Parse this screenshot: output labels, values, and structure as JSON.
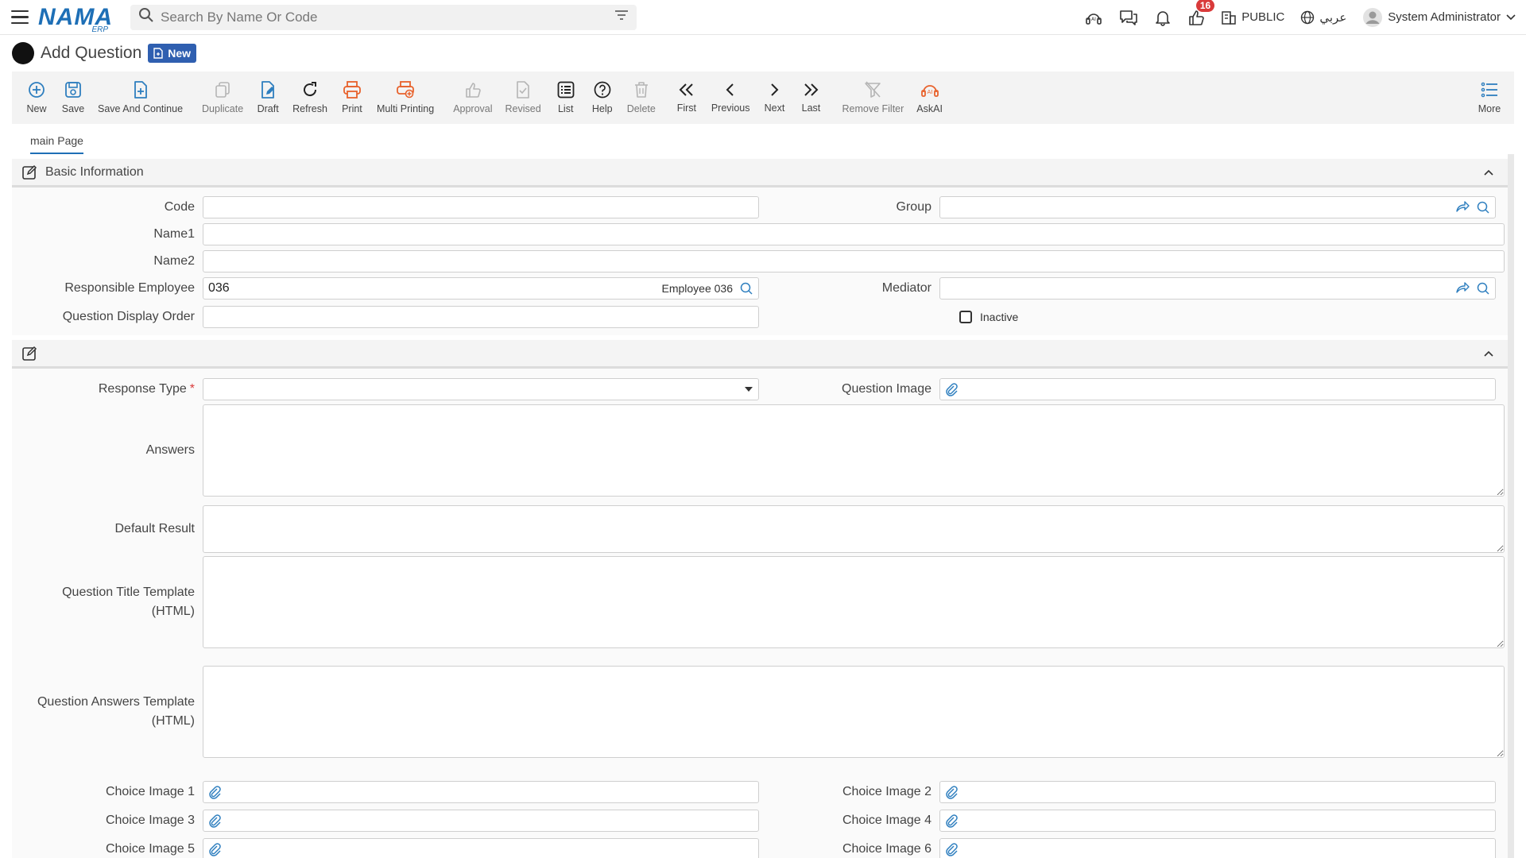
{
  "topbar": {
    "logo_main": "NAMA",
    "logo_sub": "ERP",
    "search_placeholder": "Search By Name Or Code",
    "notifications_count": "16",
    "public_label": "PUBLIC",
    "language_label": "عربي",
    "user_name": "System Administrator"
  },
  "page": {
    "title": "Add Question",
    "status_badge": "New"
  },
  "toolbar": {
    "items": [
      {
        "label": "New",
        "icon": "plus-circle-icon"
      },
      {
        "label": "Save",
        "icon": "save-icon"
      },
      {
        "label": "Save And Continue",
        "icon": "save-continue-icon"
      },
      {
        "label": "Duplicate",
        "icon": "duplicate-icon"
      },
      {
        "label": "Draft",
        "icon": "draft-icon"
      },
      {
        "label": "Refresh",
        "icon": "refresh-icon"
      },
      {
        "label": "Print",
        "icon": "print-icon"
      },
      {
        "label": "Multi Printing",
        "icon": "multi-print-icon"
      },
      {
        "label": "Approval",
        "icon": "approval-icon"
      },
      {
        "label": "Revised",
        "icon": "revised-icon"
      },
      {
        "label": "List",
        "icon": "list-icon"
      },
      {
        "label": "Help",
        "icon": "help-icon"
      },
      {
        "label": "Delete",
        "icon": "delete-icon"
      },
      {
        "label": "First",
        "icon": "first-icon"
      },
      {
        "label": "Previous",
        "icon": "previous-icon"
      },
      {
        "label": "Next",
        "icon": "next-icon"
      },
      {
        "label": "Last",
        "icon": "last-icon"
      },
      {
        "label": "Remove Filter",
        "icon": "remove-filter-icon"
      },
      {
        "label": "AskAI",
        "icon": "ai-icon"
      },
      {
        "label": "More",
        "icon": "more-icon"
      }
    ],
    "colors": {
      "primary": "#2f7fbf",
      "orange": "#e8622c",
      "disabled": "#b5b5b5",
      "dark": "#333333"
    }
  },
  "tabs": {
    "main": "main Page"
  },
  "basic_info": {
    "title": "Basic Information",
    "code_label": "Code",
    "code_value": "",
    "group_label": "Group",
    "group_value": "",
    "name1_label": "Name1",
    "name1_value": "",
    "name2_label": "Name2",
    "name2_value": "",
    "responsible_label": "Responsible Employee",
    "responsible_code": "036",
    "responsible_name": "Employee 036",
    "mediator_label": "Mediator",
    "mediator_value": "",
    "display_order_label": "Question Display Order",
    "display_order_value": "",
    "inactive_label": "Inactive"
  },
  "details": {
    "response_type_label": "Response Type",
    "response_type_required": "*",
    "question_image_label": "Question Image",
    "answers_label": "Answers",
    "default_result_label": "Default Result",
    "title_template_label_1": "Question Title Template",
    "title_template_label_2": "(HTML)",
    "answers_template_label_1": "Question Answers Template",
    "answers_template_label_2": "(HTML)",
    "choice_image_1": "Choice Image 1",
    "choice_image_2": "Choice Image 2",
    "choice_image_3": "Choice Image 3",
    "choice_image_4": "Choice Image 4",
    "choice_image_5": "Choice Image 5",
    "choice_image_6": "Choice Image 6"
  }
}
